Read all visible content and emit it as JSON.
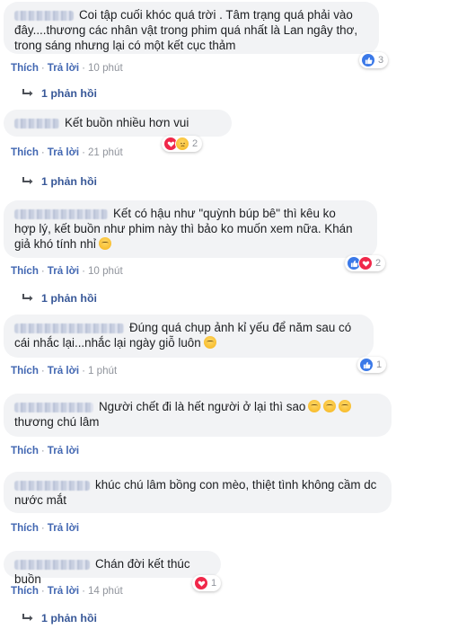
{
  "labels": {
    "like": "Thích",
    "reply": "Trả lời",
    "separator": "·"
  },
  "comments": [
    {
      "text": "Coi tập cuối khóc quá trời . Tâm trạng quá phải vào đây....thương các nhân vật trong phim quá nhất là Lan ngây thơ, trong sáng nhưng lại có một kết cục thảm",
      "time": "10 phút",
      "reactions": [
        "like-icon"
      ],
      "reaction_count": "3",
      "replies": "1 phản hồi"
    },
    {
      "text": "Kết buồn nhiều hơn vui",
      "time": "21 phút",
      "reactions": [
        "love-icon",
        "sad-icon"
      ],
      "reaction_count": "2",
      "replies": "1 phản hồi"
    },
    {
      "text": "Kết có hậu như \"quỳnh búp bê\" thì kêu ko hợp lý, kết buồn như phim này thì bảo ko muốn xem nữa. Khán giả khó tính nhỉ",
      "time": "10 phút",
      "reactions": [
        "like-icon",
        "love-icon"
      ],
      "reaction_count": "2",
      "replies": "1 phản hồi"
    },
    {
      "text": "Đúng quá chụp ảnh kỉ yếu để năm sau có cái nhắc lại...nhắc lại ngày giỗ luôn",
      "time": "1 phút",
      "reactions": [
        "like-icon"
      ],
      "reaction_count": "1",
      "replies": ""
    },
    {
      "text": "Người chết đi là hết người ở lại thì sao",
      "text2": "thương chú lâm",
      "time": "",
      "reactions": [],
      "reaction_count": "",
      "replies": ""
    },
    {
      "text": "khúc chú lâm bồng con mèo, thiệt tình không cầm dc nước mắt",
      "time": "",
      "reactions": [],
      "reaction_count": "",
      "replies": ""
    },
    {
      "text": "Chán đời kết thúc buồn",
      "time": "14 phút",
      "reactions": [
        "love-icon"
      ],
      "reaction_count": "1",
      "replies": "1 phản hồi"
    }
  ]
}
